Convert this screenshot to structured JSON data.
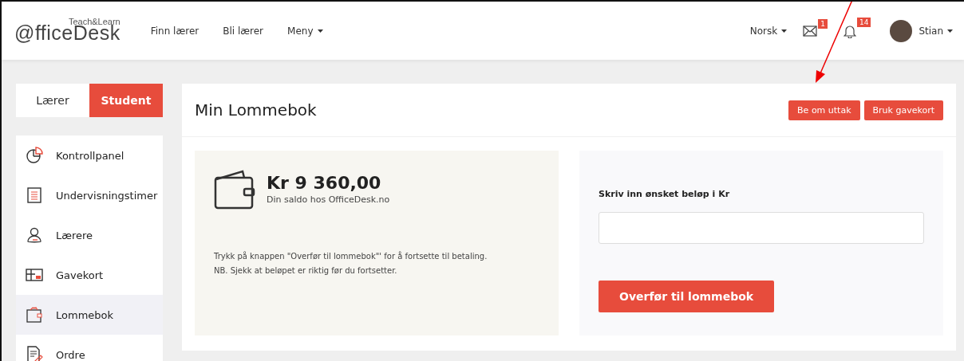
{
  "header": {
    "logo": {
      "main": "@fficeDesk",
      "tagline": "Teach&Learn"
    },
    "nav": [
      {
        "label": "Finn lærer",
        "dropdown": false
      },
      {
        "label": "Bli lærer",
        "dropdown": false
      },
      {
        "label": "Meny",
        "dropdown": true
      }
    ],
    "language": "Norsk",
    "mail_badge": "1",
    "notification_badge": "14",
    "user": "Stian"
  },
  "role_tabs": [
    {
      "label": "Lærer",
      "selected": false
    },
    {
      "label": "Student",
      "selected": true
    }
  ],
  "sidebar": {
    "items": [
      {
        "label": "Kontrollpanel",
        "kind": "chart",
        "selected": false
      },
      {
        "label": "Undervisningstimer",
        "kind": "list",
        "selected": false
      },
      {
        "label": "Lærere",
        "kind": "person",
        "selected": false
      },
      {
        "label": "Gavekort",
        "kind": "card",
        "selected": false
      },
      {
        "label": "Lommebok",
        "kind": "wallet",
        "selected": true
      },
      {
        "label": "Ordre",
        "kind": "doc",
        "selected": false
      }
    ]
  },
  "page": {
    "title": "Min Lommebok",
    "buttons": [
      "Be om uttak",
      "Bruk gavekort"
    ],
    "balance": {
      "amount": "Kr 9 360,00",
      "caption": "Din saldo hos OfficeDesk.no",
      "notes": [
        "Trykk på knappen \"Overfør til lommebok\"' for å fortsette til betaling.",
        "NB. Sjekk at beløpet er riktig før du fortsetter."
      ]
    },
    "form": {
      "label": "Skriv inn ønsket beløp i Kr",
      "submit": "Overfør til lommebok"
    }
  }
}
